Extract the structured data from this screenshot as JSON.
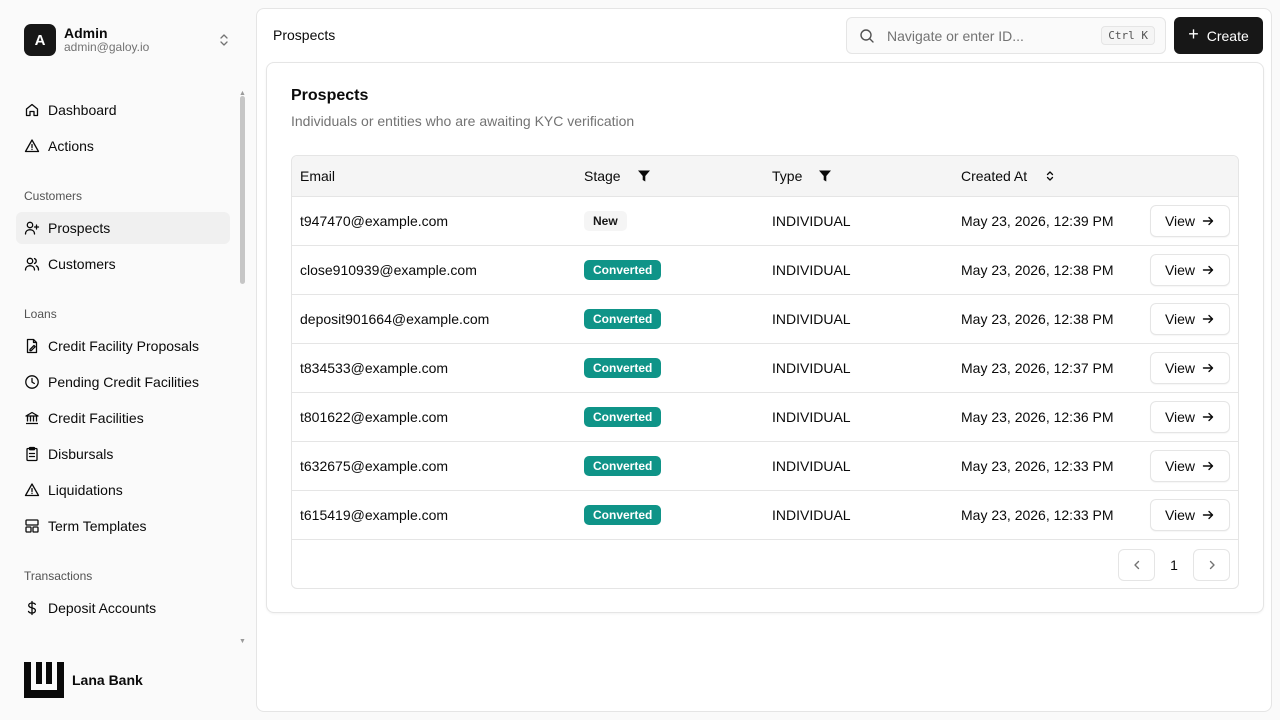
{
  "account": {
    "initial": "A",
    "name": "Admin",
    "email": "admin@galoy.io"
  },
  "nav": {
    "main": [
      {
        "label": "Dashboard",
        "icon": "home-icon"
      },
      {
        "label": "Actions",
        "icon": "alert-triangle-icon"
      }
    ],
    "customers_label": "Customers",
    "customers": [
      {
        "label": "Prospects",
        "icon": "user-plus-icon",
        "active": true
      },
      {
        "label": "Customers",
        "icon": "users-icon"
      }
    ],
    "loans_label": "Loans",
    "loans": [
      {
        "label": "Credit Facility Proposals",
        "icon": "file-edit-icon"
      },
      {
        "label": "Pending Credit Facilities",
        "icon": "clock-icon"
      },
      {
        "label": "Credit Facilities",
        "icon": "bank-icon"
      },
      {
        "label": "Disbursals",
        "icon": "clipboard-icon"
      },
      {
        "label": "Liquidations",
        "icon": "alert-triangle-icon"
      },
      {
        "label": "Term Templates",
        "icon": "layout-icon"
      }
    ],
    "transactions_label": "Transactions",
    "transactions": [
      {
        "label": "Deposit Accounts",
        "icon": "dollar-icon"
      }
    ]
  },
  "brand": {
    "name": "Lana Bank"
  },
  "header": {
    "breadcrumb": "Prospects",
    "search_placeholder": "Navigate or enter ID...",
    "shortcut": "Ctrl K",
    "create_label": "Create"
  },
  "card": {
    "title": "Prospects",
    "description": "Individuals or entities who are awaiting KYC verification"
  },
  "table": {
    "columns": {
      "email": "Email",
      "stage": "Stage",
      "type": "Type",
      "created_at": "Created At"
    },
    "view_label": "View",
    "rows": [
      {
        "email": "t947470@example.com",
        "stage": "New",
        "type": "INDIVIDUAL",
        "created_at": "May 23, 2026, 12:39 PM"
      },
      {
        "email": "close910939@example.com",
        "stage": "Converted",
        "type": "INDIVIDUAL",
        "created_at": "May 23, 2026, 12:38 PM"
      },
      {
        "email": "deposit901664@example.com",
        "stage": "Converted",
        "type": "INDIVIDUAL",
        "created_at": "May 23, 2026, 12:38 PM"
      },
      {
        "email": "t834533@example.com",
        "stage": "Converted",
        "type": "INDIVIDUAL",
        "created_at": "May 23, 2026, 12:37 PM"
      },
      {
        "email": "t801622@example.com",
        "stage": "Converted",
        "type": "INDIVIDUAL",
        "created_at": "May 23, 2026, 12:36 PM"
      },
      {
        "email": "t632675@example.com",
        "stage": "Converted",
        "type": "INDIVIDUAL",
        "created_at": "May 23, 2026, 12:33 PM"
      },
      {
        "email": "t615419@example.com",
        "stage": "Converted",
        "type": "INDIVIDUAL",
        "created_at": "May 23, 2026, 12:33 PM"
      }
    ],
    "page": "1"
  },
  "colors": {
    "converted": "#0f9488",
    "primary": "#171717"
  }
}
